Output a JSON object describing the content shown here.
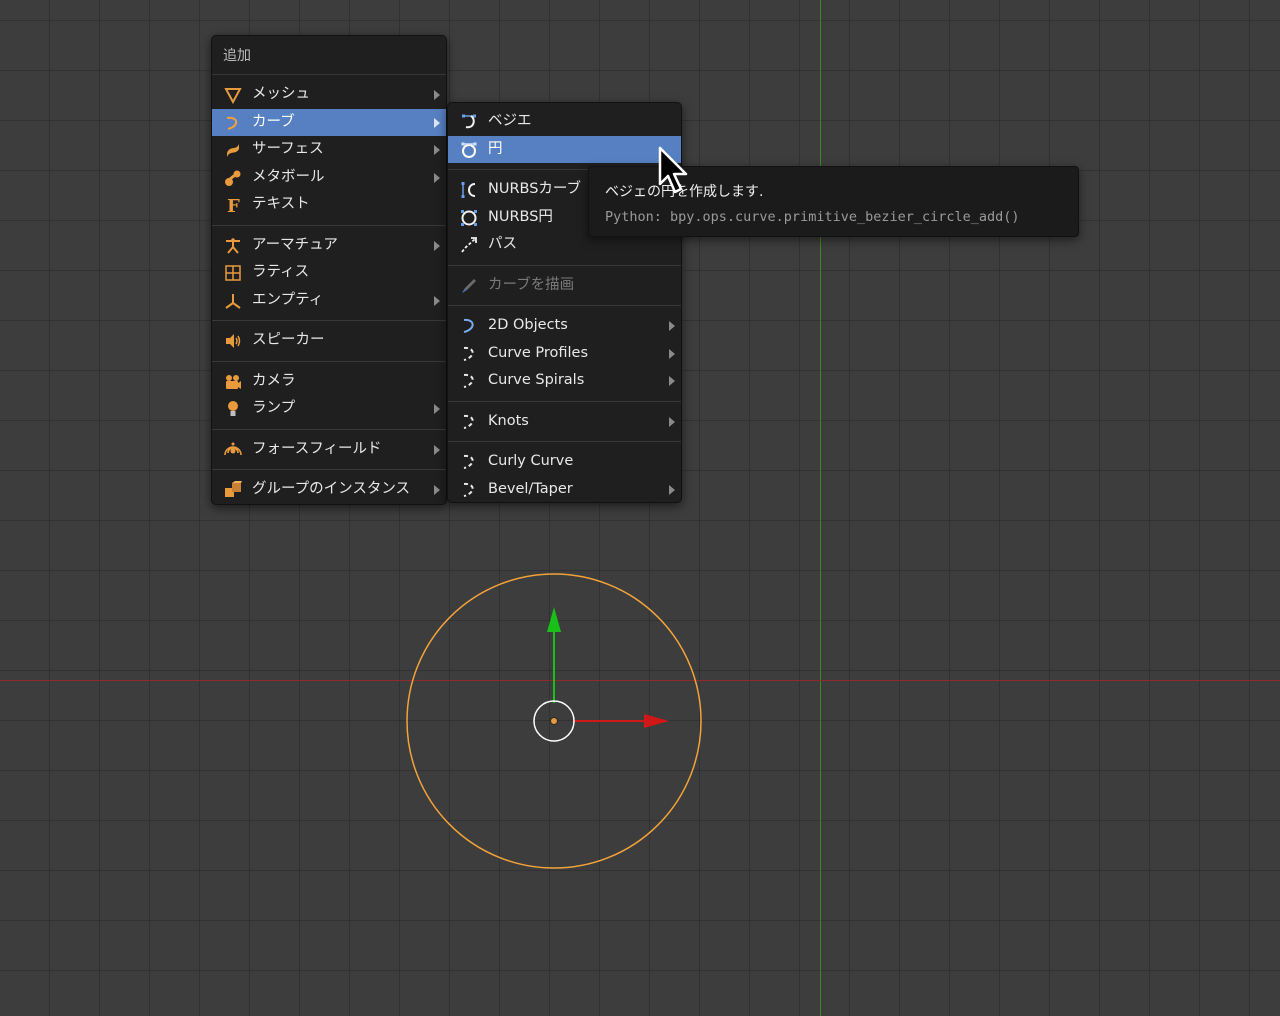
{
  "add_menu": {
    "title": "追加",
    "items": [
      {
        "label": "メッシュ",
        "icon": "mesh-icon",
        "submenu": true
      },
      {
        "label": "カーブ",
        "icon": "curve-icon",
        "submenu": true,
        "active": true
      },
      {
        "label": "サーフェス",
        "icon": "surface-icon",
        "submenu": true
      },
      {
        "label": "メタボール",
        "icon": "metaball-icon",
        "submenu": true
      },
      {
        "label": "テキスト",
        "icon": "text-icon",
        "submenu": false
      },
      {
        "label": "アーマチュア",
        "icon": "armature-icon",
        "submenu": true
      },
      {
        "label": "ラティス",
        "icon": "lattice-icon",
        "submenu": false
      },
      {
        "label": "エンプティ",
        "icon": "empty-icon",
        "submenu": true
      },
      {
        "label": "スピーカー",
        "icon": "speaker-icon",
        "submenu": false
      },
      {
        "label": "カメラ",
        "icon": "camera-icon",
        "submenu": false
      },
      {
        "label": "ランプ",
        "icon": "lamp-icon",
        "submenu": true
      },
      {
        "label": "フォースフィールド",
        "icon": "force-field-icon",
        "submenu": true
      },
      {
        "label": "グループのインスタンス",
        "icon": "group-instance-icon",
        "submenu": true
      }
    ]
  },
  "curve_menu": {
    "items": [
      {
        "label": "ベジエ",
        "icon": "bezier-curve-icon"
      },
      {
        "label": "円",
        "icon": "bezier-circle-icon",
        "active": true
      },
      {
        "label": "NURBSカーブ",
        "icon": "nurbs-curve-icon"
      },
      {
        "label": "NURBS円",
        "icon": "nurbs-circle-icon"
      },
      {
        "label": "パス",
        "icon": "path-icon"
      },
      {
        "label": "カーブを描画",
        "icon": "draw-curve-icon",
        "disabled": true
      },
      {
        "label": "2D Objects",
        "icon": "2d-objects-icon",
        "submenu": true
      },
      {
        "label": "Curve Profiles",
        "icon": "curve-profiles-icon",
        "submenu": true
      },
      {
        "label": "Curve Spirals",
        "icon": "curve-spirals-icon",
        "submenu": true
      },
      {
        "label": "Knots",
        "icon": "knots-icon",
        "submenu": true
      },
      {
        "label": "Curly Curve",
        "icon": "curly-curve-icon"
      },
      {
        "label": "Bevel/Taper",
        "icon": "bevel-taper-icon",
        "submenu": true
      }
    ]
  },
  "tooltip": {
    "title": "ベジェの円を作成します.",
    "python": "Python: bpy.ops.curve.primitive_bezier_circle_add()"
  },
  "colors": {
    "accent": "#5680c2",
    "icon_orange": "#e89a3c",
    "selected_object": "#f2a33a",
    "gizmo_x": "#d01818",
    "gizmo_y": "#18c018"
  }
}
